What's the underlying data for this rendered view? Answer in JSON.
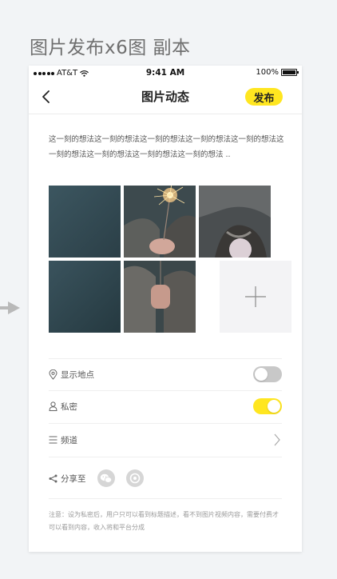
{
  "artboard": {
    "title": "图片发布x6图 副本"
  },
  "status_bar": {
    "carrier": "AT&T",
    "time": "9:41 AM",
    "battery": "100%"
  },
  "nav": {
    "title": "图片动态",
    "publish_label": "发布"
  },
  "post": {
    "text": "这一刻的想法这一刻的想法这一刻的想法这一刻的想法这一刻的想法这一刻的想法这一刻的想法这一刻的想法这一刻的想法 .."
  },
  "options": {
    "location": {
      "label": "显示地点",
      "enabled": false
    },
    "private": {
      "label": "私密",
      "enabled": true
    },
    "channel": {
      "label": "频道"
    },
    "share": {
      "label": "分享至",
      "icons": [
        "wechat-icon",
        "moments-icon"
      ]
    }
  },
  "footnote": "注意：设为私密后，用户只可以看到标题描述，看不到图片视频内容，需要付费才可以看到内容，收入将和平台分成",
  "colors": {
    "accent": "#ffe620",
    "toggle_off": "#c8c8c8",
    "text": "#555555"
  }
}
